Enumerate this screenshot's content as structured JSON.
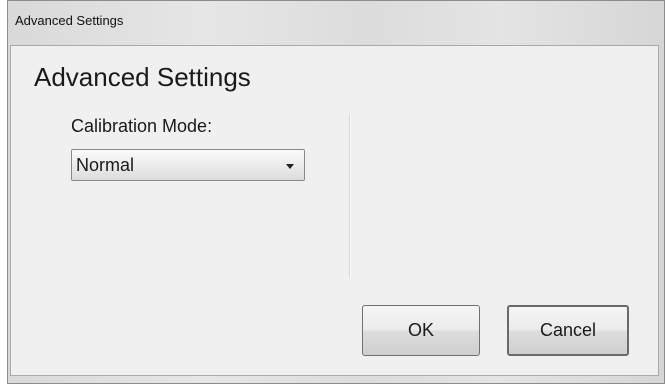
{
  "window": {
    "title": "Advanced Settings"
  },
  "dialog": {
    "heading": "Advanced Settings",
    "calibration_mode": {
      "label": "Calibration Mode:",
      "selected": "Normal"
    },
    "buttons": {
      "ok_label": "OK",
      "cancel_label": "Cancel"
    }
  }
}
